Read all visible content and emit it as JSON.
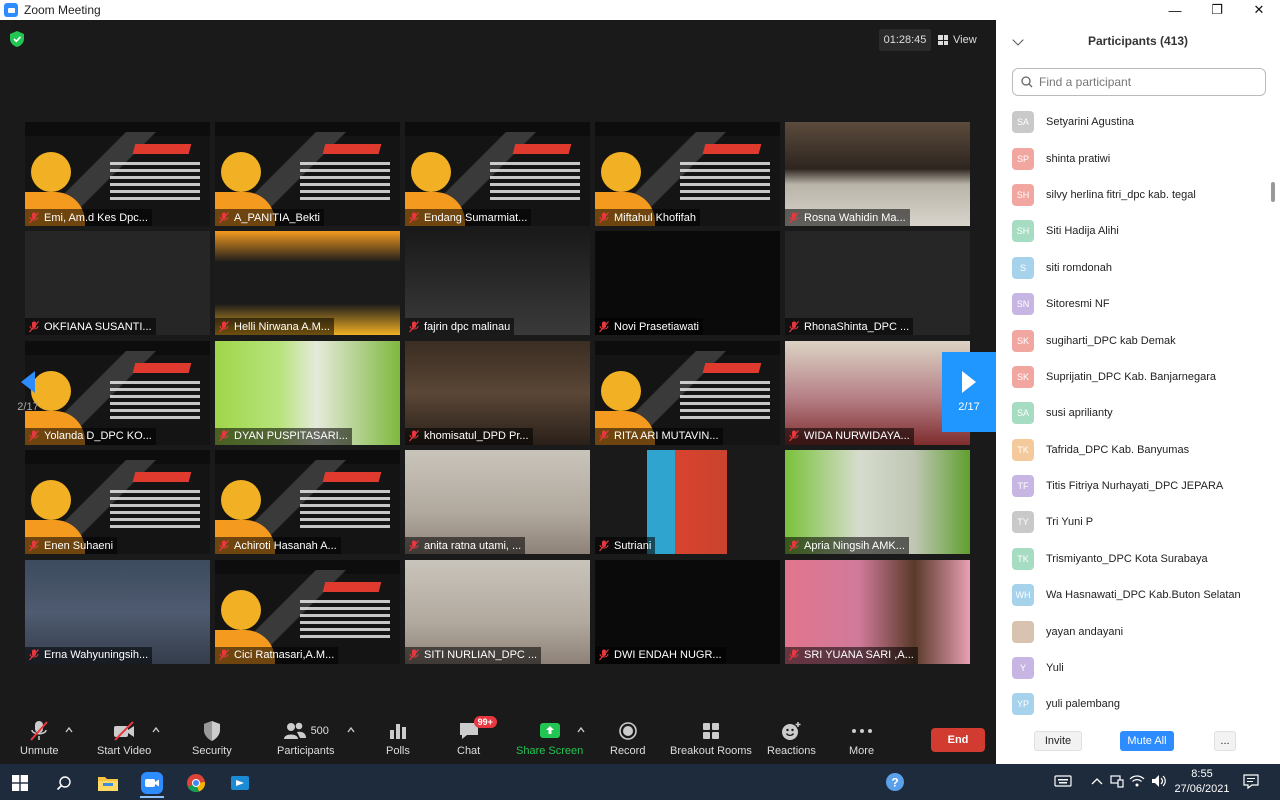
{
  "window": {
    "title": "Zoom Meeting"
  },
  "meeting": {
    "timer": "01:28:45",
    "view_label": "View",
    "page_indicator": "2/17",
    "tiles": [
      {
        "name": "Emi, Am.d Kes Dpc...",
        "bg": "poster"
      },
      {
        "name": "A_PANITIA_Bekti",
        "bg": "poster"
      },
      {
        "name": "Endang Sumarmiat...",
        "bg": "poster"
      },
      {
        "name": "Miftahul Khofifah",
        "bg": "poster"
      },
      {
        "name": "Rosna Wahidin Ma...",
        "bg": "room1"
      },
      {
        "name": "OKFIANA SUSANTI...",
        "bg": "dark"
      },
      {
        "name": "Helli Nirwana A.M...",
        "bg": "poster2"
      },
      {
        "name": "fajrin dpc malinau",
        "bg": "poster3"
      },
      {
        "name": "Novi Prasetiawati",
        "bg": "black"
      },
      {
        "name": "RhonaShinta_DPC ...",
        "bg": "dark"
      },
      {
        "name": "Yolanda D_DPC KO...",
        "bg": "poster"
      },
      {
        "name": "DYAN PUSPITASARI...",
        "bg": "green"
      },
      {
        "name": "khomisatul_DPD Pr...",
        "bg": "brown"
      },
      {
        "name": "RITA ARI MUTAVIN...",
        "bg": "poster"
      },
      {
        "name": "WIDA NURWIDAYA...",
        "bg": "kids"
      },
      {
        "name": "Enen Suhaeni",
        "bg": "poster"
      },
      {
        "name": "Achiroti Hasanah A...",
        "bg": "poster"
      },
      {
        "name": "anita ratna utami, ...",
        "bg": "wall"
      },
      {
        "name": "Sutriani",
        "bg": "phone"
      },
      {
        "name": "Apria Ningsih AMK...",
        "bg": "green2"
      },
      {
        "name": "Erna Wahyuningsih...",
        "bg": "blue"
      },
      {
        "name": "Cici Ratnasari,A.M...",
        "bg": "poster"
      },
      {
        "name": "SITI NURLIAN_DPC ...",
        "bg": "wall"
      },
      {
        "name": "DWI ENDAH NUGR...",
        "bg": "black"
      },
      {
        "name": "SRI YUANA SARI ,A...",
        "bg": "pink"
      }
    ]
  },
  "toolbar": {
    "unmute": "Unmute",
    "start_video": "Start Video",
    "security": "Security",
    "participants": "Participants",
    "participants_count": "500",
    "polls": "Polls",
    "chat": "Chat",
    "chat_badge": "99+",
    "share_screen": "Share Screen",
    "record": "Record",
    "breakout_rooms": "Breakout Rooms",
    "reactions": "Reactions",
    "more": "More",
    "end": "End"
  },
  "panel": {
    "title": "Participants (413)",
    "search_placeholder": "Find a participant",
    "participants": [
      {
        "initials": "SA",
        "name": "Setyarini Agustina",
        "color": "#c9c9c9"
      },
      {
        "initials": "SP",
        "name": "shinta pratiwi",
        "color": "#f2a6a0"
      },
      {
        "initials": "SH",
        "name": "silvy herlina fitri_dpc kab. tegal",
        "color": "#f2a6a0"
      },
      {
        "initials": "SH",
        "name": "Siti Hadija Alihi",
        "color": "#a6dcc1"
      },
      {
        "initials": "S",
        "name": "siti romdonah",
        "color": "#a6d2ec"
      },
      {
        "initials": "SN",
        "name": "Sitoresmi NF",
        "color": "#c7b6e3"
      },
      {
        "initials": "SK",
        "name": "sugiharti_DPC kab Demak",
        "color": "#f2a6a0"
      },
      {
        "initials": "SK",
        "name": "Suprijatin_DPC Kab. Banjarnegara",
        "color": "#f2a6a0"
      },
      {
        "initials": "SA",
        "name": "susi aprilianty",
        "color": "#a6dcc1"
      },
      {
        "initials": "TK",
        "name": "Tafrida_DPC Kab. Banyumas",
        "color": "#f4c99b"
      },
      {
        "initials": "TF",
        "name": "Titis Fitriya Nurhayati_DPC JEPARA",
        "color": "#c7b6e3"
      },
      {
        "initials": "TY",
        "name": "Tri Yuni P",
        "color": "#c9c9c9"
      },
      {
        "initials": "TK",
        "name": "Trismiyanto_DPC Kota Surabaya",
        "color": "#a6dcc1"
      },
      {
        "initials": "WH",
        "name": "Wa Hasnawati_DPC Kab.Buton Selatan",
        "color": "#a6d2ec"
      },
      {
        "initials": "",
        "name": "yayan andayani",
        "color": "#d8c2b0"
      },
      {
        "initials": "Y",
        "name": "Yuli",
        "color": "#c7b6e3"
      },
      {
        "initials": "YP",
        "name": "yuli  palembang",
        "color": "#a6d2ec"
      }
    ],
    "invite": "Invite",
    "mute_all": "Mute All",
    "more": "..."
  },
  "taskbar": {
    "time": "8:55",
    "date": "27/06/2021"
  }
}
